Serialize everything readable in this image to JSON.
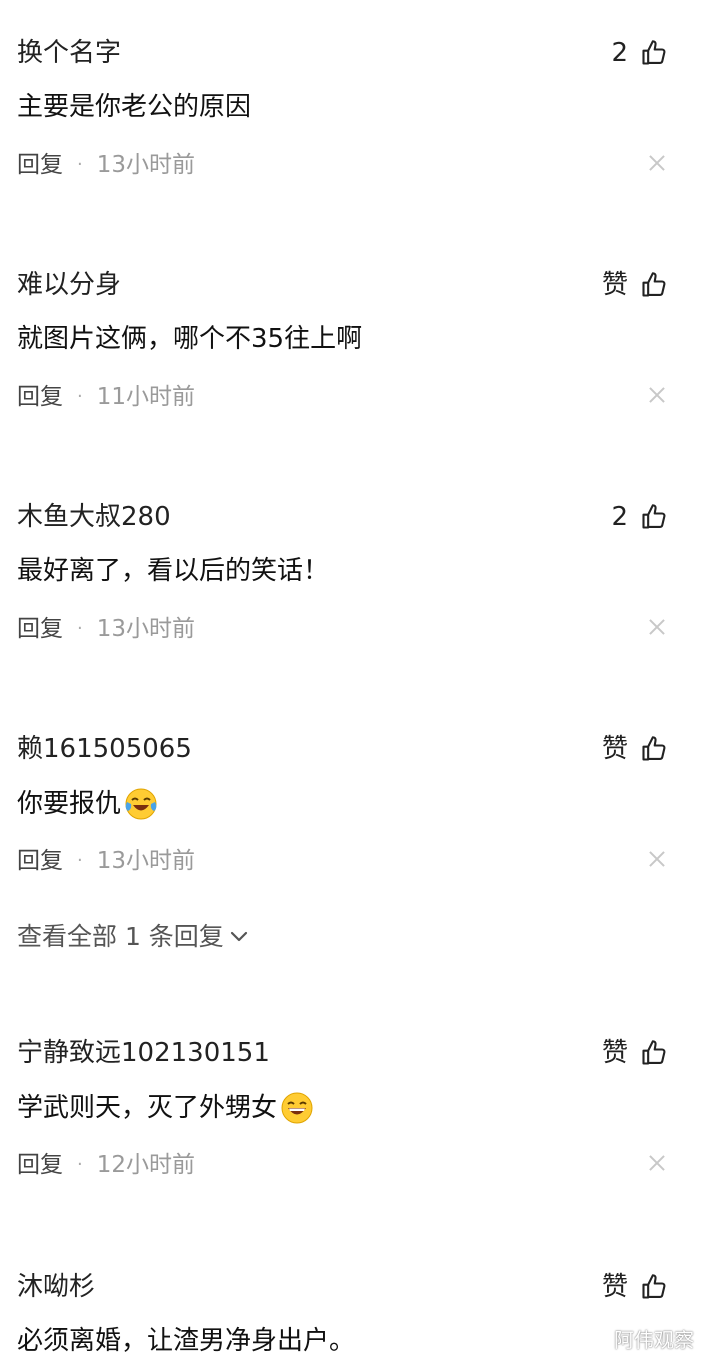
{
  "comments": [
    {
      "username": "换个名字",
      "like": "2",
      "text": "主要是你老公的原因",
      "reply": "回复",
      "time": "13小时前",
      "emoji": ""
    },
    {
      "username": "难以分身",
      "like": "赞",
      "text": "就图片这俩，哪个不35往上啊",
      "reply": "回复",
      "time": "11小时前",
      "emoji": ""
    },
    {
      "username": "木鱼大叔280",
      "like": "2",
      "text": "最好离了，看以后的笑话！",
      "reply": "回复",
      "time": "13小时前",
      "emoji": ""
    },
    {
      "username": "赖161505065",
      "like": "赞",
      "text": "你要报仇",
      "reply": "回复",
      "time": "13小时前",
      "emoji": "laughing-crying-emoji"
    },
    {
      "username": "宁静致远102130151",
      "like": "赞",
      "text": "学武则天，灭了外甥女",
      "reply": "回复",
      "time": "12小时前",
      "emoji": "grinning-emoji"
    },
    {
      "username": "沐呦杉",
      "like": "赞",
      "text": "必须离婚，让渣男净身出户。",
      "reply": "",
      "time": "",
      "emoji": ""
    }
  ],
  "view_more": {
    "label": "查看全部 1 条回复"
  },
  "meta": {
    "separator": "·"
  },
  "watermark": "阿伟观察",
  "icons": {
    "like": "thumbs-up-icon",
    "close": "close-icon",
    "expand": "chevron-down-icon"
  },
  "colors": {
    "text": "#111111",
    "muted": "#9a9a9a",
    "icon": "#222222"
  }
}
